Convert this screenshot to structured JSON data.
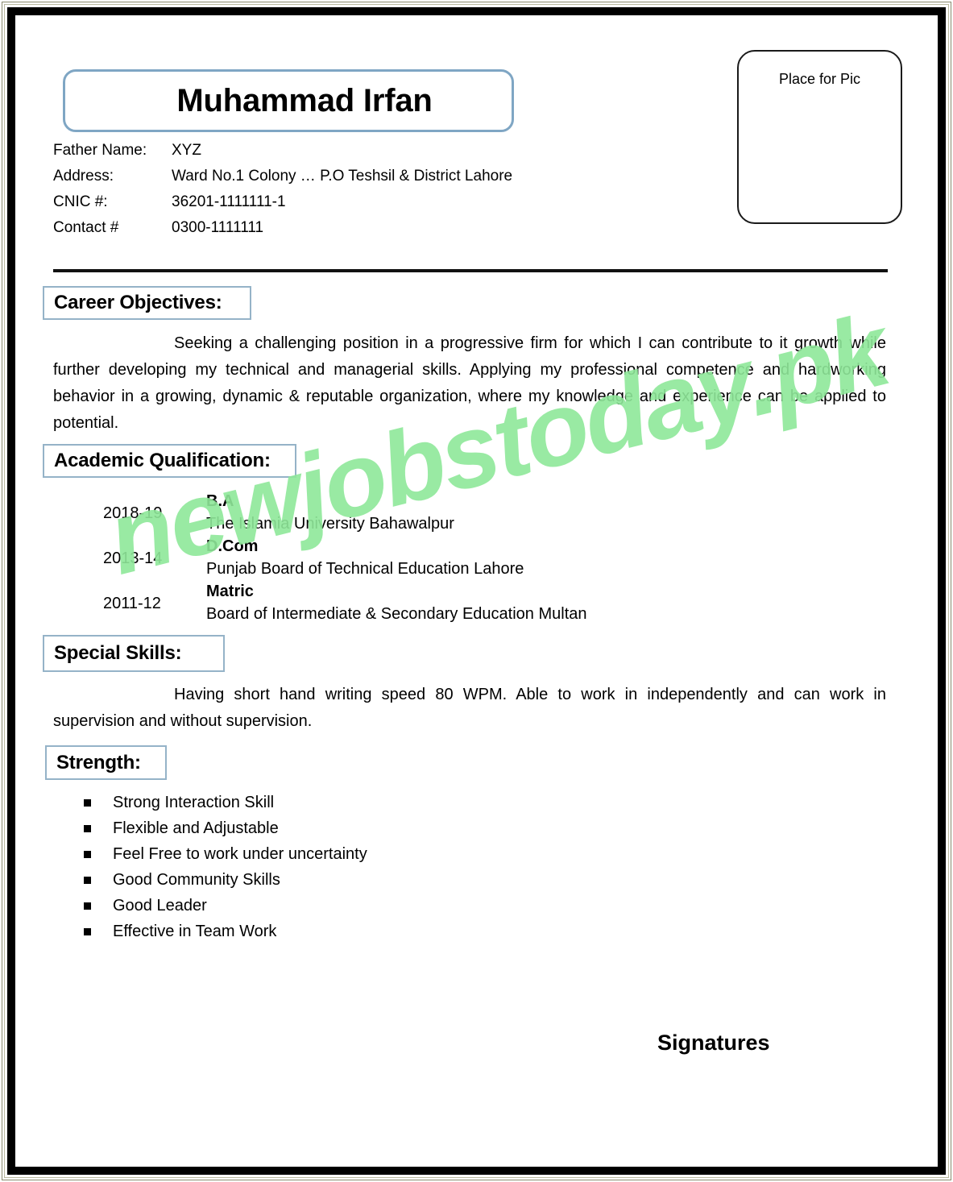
{
  "document": {
    "type": "resume",
    "name_banner": "Muhammad Irfan",
    "photo_placeholder": "Place for Pic",
    "signature_label": "Signatures",
    "watermark": "newjobstoday.pk"
  },
  "colors": {
    "heading_border": "#95b3c8",
    "name_box_border": "#7fa6c4",
    "watermark": "#8fe89a",
    "page_border": "#000000",
    "text": "#000000"
  },
  "personal_info": {
    "rows": [
      {
        "label": "Father Name:",
        "value": "XYZ"
      },
      {
        "label": "Address:",
        "value": "Ward No.1 Colony … P.O Teshsil & District Lahore"
      },
      {
        "label": "CNIC #:",
        "value": "36201-1111111-1"
      },
      {
        "label": "Contact #",
        "value": "0300-1111111"
      }
    ]
  },
  "sections": {
    "career": {
      "heading": "Career Objectives:",
      "body": "Seeking a challenging position in a progressive firm for which I can contribute to it growth while further developing my technical and managerial skills. Applying my professional competence and hardworking behavior in a growing, dynamic & reputable organization, where my knowledge and experience can be applied to potential."
    },
    "academic": {
      "heading": "Academic Qualification:",
      "entries": [
        {
          "year": "2018-19",
          "degree": "B.A",
          "institution": "The Islamia University Bahawalpur"
        },
        {
          "year": "2013-14",
          "degree": "D.Com",
          "institution": "Punjab Board of Technical Education Lahore"
        },
        {
          "year": "2011-12",
          "degree": "Matric",
          "institution": "Board of Intermediate & Secondary Education Multan"
        }
      ]
    },
    "special_skills": {
      "heading": "Special Skills:",
      "body": "Having short hand writing speed 80 WPM. Able to work in independently and can work in supervision and without supervision."
    },
    "strength": {
      "heading": "Strength:",
      "items": [
        "Strong Interaction Skill",
        "Flexible and Adjustable",
        "Feel Free to work under uncertainty",
        "Good Community Skills",
        "Good Leader",
        "Effective in Team Work"
      ]
    }
  }
}
